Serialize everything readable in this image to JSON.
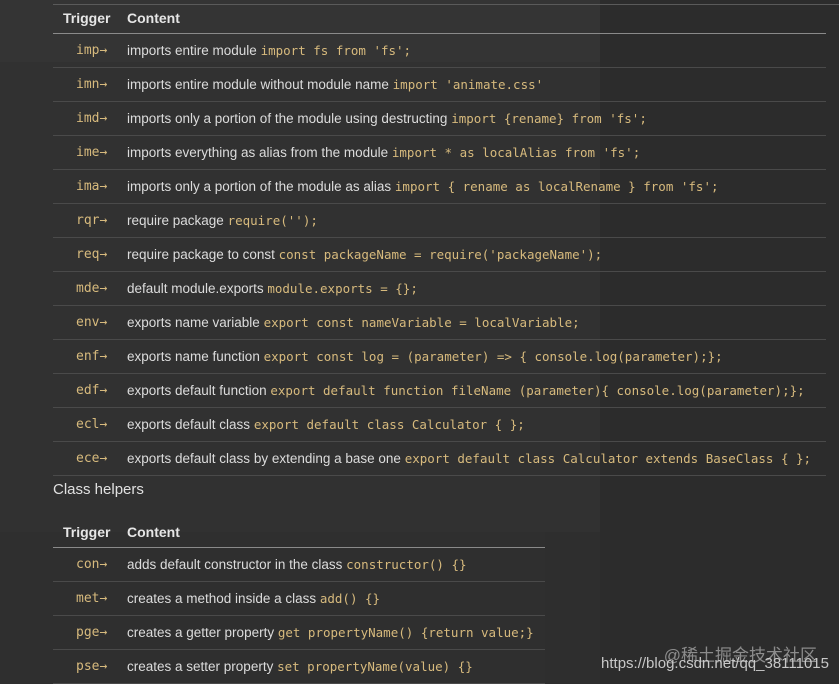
{
  "table1": {
    "headers": {
      "trigger": "Trigger",
      "content": "Content"
    },
    "rows": [
      {
        "trigger": "imp→",
        "text": "imports entire module ",
        "code": "import fs from 'fs';"
      },
      {
        "trigger": "imn→",
        "text": "imports entire module without module name ",
        "code": "import 'animate.css'"
      },
      {
        "trigger": "imd→",
        "text": "imports only a portion of the module using destructing ",
        "code": "import {rename} from 'fs';"
      },
      {
        "trigger": "ime→",
        "text": "imports everything as alias from the module ",
        "code": "import * as localAlias from 'fs';"
      },
      {
        "trigger": "ima→",
        "text": "imports only a portion of the module as alias ",
        "code": "import { rename as localRename } from 'fs';"
      },
      {
        "trigger": "rqr→",
        "text": "require package ",
        "code": "require('');"
      },
      {
        "trigger": "req→",
        "text": "require package to const ",
        "code": "const packageName = require('packageName');"
      },
      {
        "trigger": "mde→",
        "text": "default module.exports ",
        "code": "module.exports = {};"
      },
      {
        "trigger": "env→",
        "text": "exports name variable ",
        "code": "export const nameVariable = localVariable;"
      },
      {
        "trigger": "enf→",
        "text": "exports name function ",
        "code": "export const log = (parameter) => { console.log(parameter);};"
      },
      {
        "trigger": "edf→",
        "text": "exports default function ",
        "code": "export default function fileName (parameter){ console.log(parameter);};"
      },
      {
        "trigger": "ecl→",
        "text": "exports default class ",
        "code": "export default class Calculator { };"
      },
      {
        "trigger": "ece→",
        "text": "exports default class by extending a base one ",
        "code": "export default class Calculator extends BaseClass { };"
      }
    ]
  },
  "section_heading": "Class helpers",
  "table2": {
    "headers": {
      "trigger": "Trigger",
      "content": "Content"
    },
    "rows": [
      {
        "trigger": "con→",
        "text": "adds default constructor in the class ",
        "code": "constructor() {}"
      },
      {
        "trigger": "met→",
        "text": "creates a method inside a class ",
        "code": "add() {}"
      },
      {
        "trigger": "pge→",
        "text": "creates a getter property ",
        "code": "get propertyName() {return value;}"
      },
      {
        "trigger": "pse→",
        "text": "creates a setter property ",
        "code": "set propertyName(value) {}"
      }
    ]
  },
  "watermark": {
    "line1": "@稀土掘金技术社区",
    "line2": "https://blog.csdn.net/qq_38111015"
  },
  "colors": {
    "background": "#2e2e2e",
    "code": "#d7ba7d",
    "text": "#dcdcdc"
  }
}
